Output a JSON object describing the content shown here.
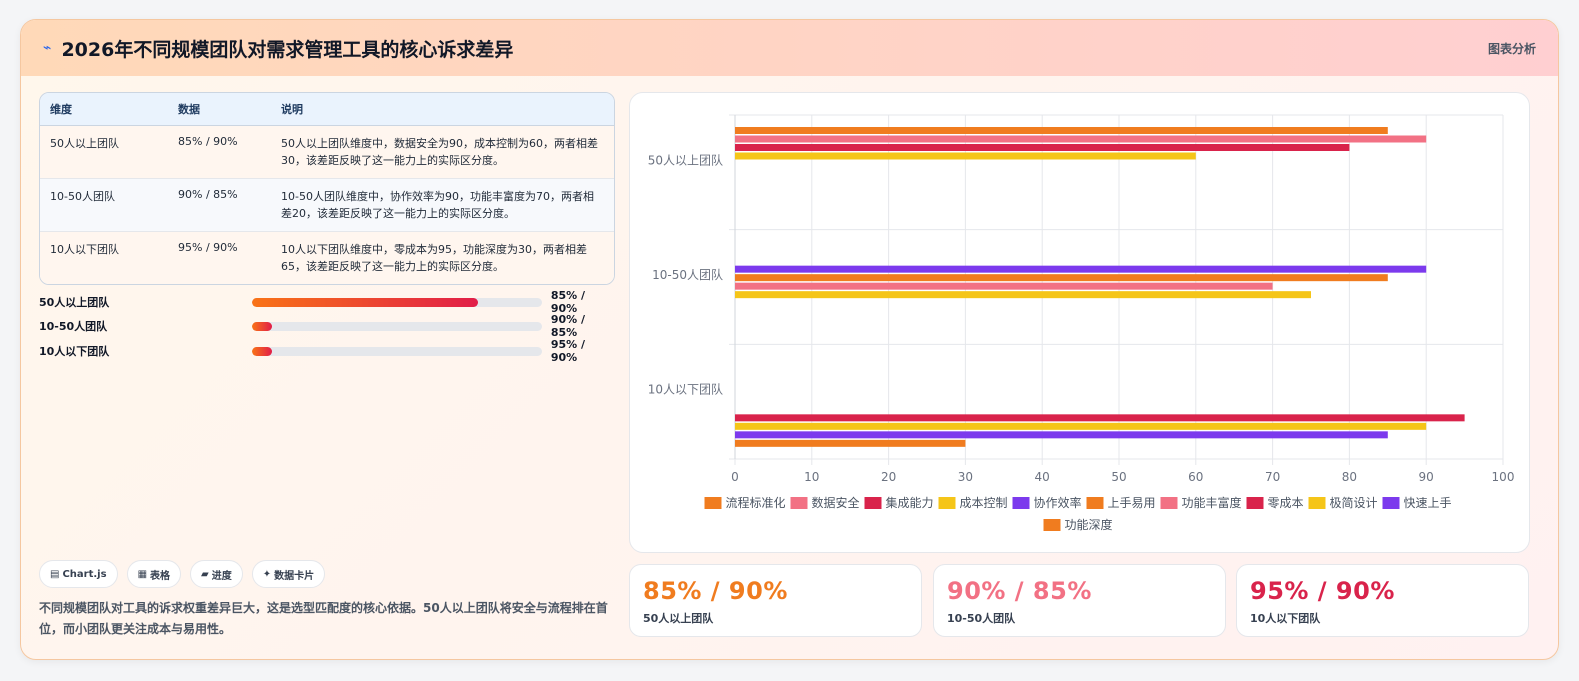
{
  "header": {
    "icon": "lightning-icon",
    "title": "2026年不同规模团队对需求管理工具的核心诉求差异",
    "tag": "图表分析"
  },
  "table": {
    "headers": [
      "维度",
      "数据",
      "说明"
    ],
    "rows": [
      {
        "dim": "50人以上团队",
        "data": "85% / 90%",
        "note": "50人以上团队维度中，数据安全为90，成本控制为60，两者相差30，该差距反映了这一能力上的实际区分度。"
      },
      {
        "dim": "10-50人团队",
        "data": "90% / 85%",
        "note": "10-50人团队维度中，协作效率为90，功能丰富度为70，两者相差20，该差距反映了这一能力上的实际区分度。"
      },
      {
        "dim": "10人以下团队",
        "data": "95% / 90%",
        "note": "10人以下团队维度中，零成本为95，功能深度为30，两者相差65，该差距反映了这一能力上的实际区分度。"
      }
    ]
  },
  "progress": [
    {
      "label": "50人以上团队",
      "value": "85% / 90%",
      "fill": 0.78
    },
    {
      "label": "10-50人团队",
      "value": "90% / 85%",
      "fill": 0.07
    },
    {
      "label": "10人以下团队",
      "value": "95% / 90%",
      "fill": 0.07
    }
  ],
  "chips": [
    {
      "icon": "chart-icon",
      "glyph": "▤",
      "label": "Chart.js"
    },
    {
      "icon": "table-icon",
      "glyph": "▦",
      "label": "表格"
    },
    {
      "icon": "progress-icon",
      "glyph": "▰",
      "label": "进度"
    },
    {
      "icon": "sparkle-icon",
      "glyph": "✦",
      "label": "数据卡片"
    }
  ],
  "description": "不同规模团队对工具的诉求权重差异巨大，这是选型匹配度的核心依据。50人以上团队将安全与流程排在首位，而小团队更关注成本与易用性。",
  "kpis": [
    {
      "value": "85% / 90%",
      "label": "50人以上团队",
      "color": "#f07c1f"
    },
    {
      "value": "90% / 85%",
      "label": "10-50人团队",
      "color": "#f27184"
    },
    {
      "value": "95% / 90%",
      "label": "10人以下团队",
      "color": "#d9234b"
    }
  ],
  "chart_data": {
    "type": "bar",
    "orientation": "horizontal",
    "categories": [
      "50人以上团队",
      "10-50人团队",
      "10人以下团队"
    ],
    "xlim": [
      0,
      100
    ],
    "xticks": [
      0,
      10,
      20,
      30,
      40,
      50,
      60,
      70,
      80,
      90,
      100
    ],
    "grid": true,
    "legend_position": "bottom",
    "series": [
      {
        "name": "流程标准化",
        "color": "#f07c1f",
        "values": [
          85,
          null,
          null
        ]
      },
      {
        "name": "数据安全",
        "color": "#f27184",
        "values": [
          90,
          null,
          null
        ]
      },
      {
        "name": "集成能力",
        "color": "#d9234b",
        "values": [
          80,
          null,
          null
        ]
      },
      {
        "name": "成本控制",
        "color": "#f5c518",
        "values": [
          60,
          null,
          null
        ]
      },
      {
        "name": "协作效率",
        "color": "#7c3aed",
        "values": [
          null,
          90,
          null
        ]
      },
      {
        "name": "上手易用",
        "color": "#f07c1f",
        "values": [
          null,
          85,
          null
        ]
      },
      {
        "name": "功能丰富度",
        "color": "#f27184",
        "values": [
          null,
          70,
          null
        ]
      },
      {
        "name": "零成本",
        "color": "#d9234b",
        "values": [
          null,
          null,
          95
        ]
      },
      {
        "name": "极简设计",
        "color": "#f5c518",
        "values": [
          null,
          75,
          90
        ]
      },
      {
        "name": "快速上手",
        "color": "#7c3aed",
        "values": [
          null,
          null,
          85
        ]
      },
      {
        "name": "功能深度",
        "color": "#f07c1f",
        "values": [
          null,
          null,
          30
        ]
      }
    ]
  }
}
